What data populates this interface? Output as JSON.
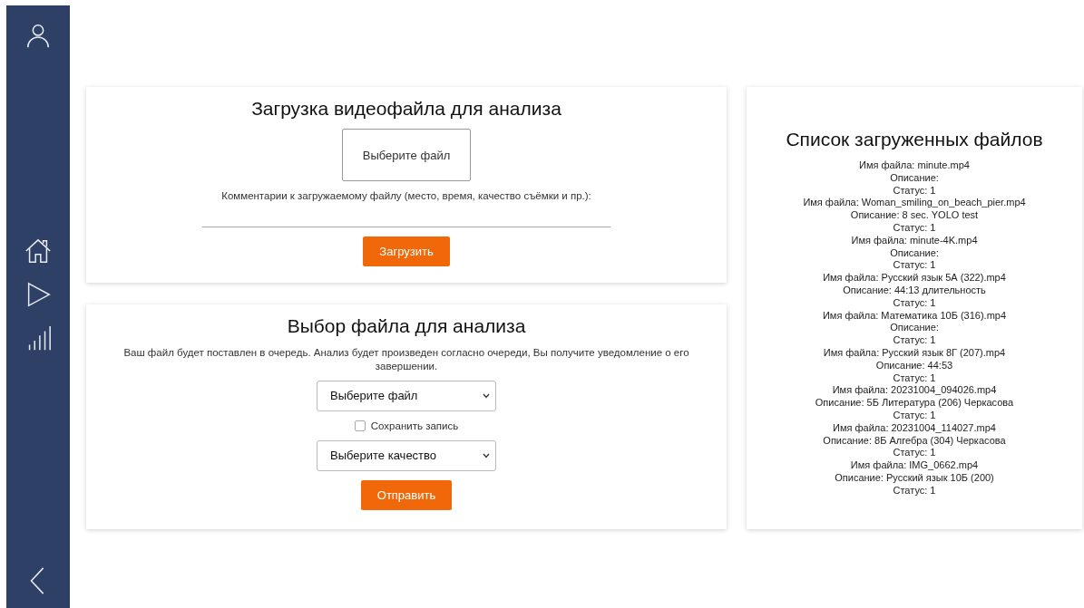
{
  "sidebar": {
    "items": [
      {
        "kind": "user"
      },
      {
        "kind": "home"
      },
      {
        "kind": "play"
      },
      {
        "kind": "bars"
      },
      {
        "kind": "back"
      }
    ]
  },
  "upload": {
    "title": "Загрузка видеофайла для анализа",
    "file_button": "Выберите файл",
    "comment_label": "Комментарии к загружаемому файлу (место, время, качество съёмки и пр.):",
    "submit": "Загрузить"
  },
  "analysis": {
    "title": "Выбор файла для анализа",
    "note": "Ваш файл будет поставлен в очередь. Анализ будет произведен согласно очереди, Вы получите уведомление о его завершении.",
    "file_select": "Выберите файл",
    "save_checkbox": {
      "label": "Сохранить запись",
      "checked": false
    },
    "quality_select": "Выберите качество",
    "submit": "Отправить"
  },
  "files": {
    "title": "Список загруженных файлов",
    "items": [
      {
        "name": "Имя файла: minute.mp4",
        "description": "Описание:",
        "status": "Статус: 1"
      },
      {
        "name": "Имя файла: Woman_smiling_on_beach_pier.mp4",
        "description": "Описание: 8 sec. YOLO test",
        "status": "Статус: 1"
      },
      {
        "name": "Имя файла: minute-4K.mp4",
        "description": "Описание:",
        "status": "Статус: 1"
      },
      {
        "name": "Имя файла: Русский язык 5А (322).mp4",
        "description": "Описание: 44:13 длительность",
        "status": "Статус: 1"
      },
      {
        "name": "Имя файла: Математика 10Б (316).mp4",
        "description": "Описание:",
        "status": "Статус: 1"
      },
      {
        "name": "Имя файла: Русский язык 8Г (207).mp4",
        "description": "Описание: 44:53",
        "status": "Статус: 1"
      },
      {
        "name": "Имя файла: 20231004_094026.mp4",
        "description": "Описание: 5Б Литература (206) Черкасова",
        "status": "Статус: 1"
      },
      {
        "name": "Имя файла: 20231004_114027.mp4",
        "description": "Описание: 8Б Алгебра (304) Черкасова",
        "status": "Статус: 1"
      },
      {
        "name": "Имя файла: IMG_0662.mp4",
        "description": "Описание: Русский язык 10Б (200)",
        "status": "Статус: 1"
      }
    ]
  }
}
